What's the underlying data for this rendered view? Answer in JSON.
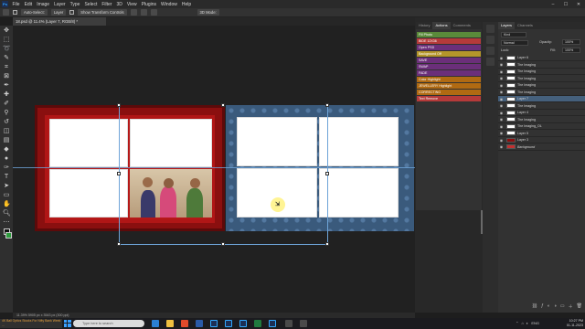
{
  "menu": [
    "File",
    "Edit",
    "Image",
    "Layer",
    "Type",
    "Select",
    "Filter",
    "3D",
    "View",
    "Plugins",
    "Window",
    "Help"
  ],
  "options": {
    "auto_select_label": "Auto-Select:",
    "layer_select": "Layer",
    "show_transform": "Show Transform Controls",
    "mode_3d": "3D Mode:"
  },
  "document": {
    "tab_title": "18.psd @ 11.4% (Layer 7, RGB/8) *",
    "status": "11.39%   5905 px x 3543 px (300 ppi)"
  },
  "panels": {
    "tabs": [
      "History",
      "Actions",
      "Comments"
    ],
    "active_tab": "Actions",
    "layers_tabs": [
      "Layers",
      "Channels"
    ]
  },
  "actions": [
    {
      "label": "Fill Photo",
      "color": "#5a8a3a"
    },
    {
      "label": "BIDE 12X36",
      "color": "#b53a3a"
    },
    {
      "label": "Open PSD",
      "color": "#6b2f7a"
    },
    {
      "label": "Background Off",
      "color": "#b4962a"
    },
    {
      "label": "SAVE",
      "color": "#6b2f7a"
    },
    {
      "label": "SWAP",
      "color": "#6b2f7a"
    },
    {
      "label": "FADE",
      "color": "#6b2f7a"
    },
    {
      "label": "Color Highlight",
      "color": "#b06a12"
    },
    {
      "label": "JEWELLERY Highlight",
      "color": "#b06a12"
    },
    {
      "label": "CORRECTING",
      "color": "#b06a12"
    },
    {
      "label": "Text Remove",
      "color": "#b53a3a"
    }
  ],
  "layers_panel": {
    "kind": "Kind",
    "mode": "Normal",
    "opacity_label": "Opacity:",
    "opacity": "100%",
    "lock_label": "Lock:",
    "fill_label": "Fill:",
    "fill": "100%",
    "rows": [
      {
        "name": "Layer 6",
        "selected": false
      },
      {
        "name": "The Imaging",
        "selected": false
      },
      {
        "name": "The Imaging",
        "selected": false
      },
      {
        "name": "The Imaging",
        "selected": false
      },
      {
        "name": "The Imaging",
        "selected": false
      },
      {
        "name": "The Imaging",
        "selected": false
      },
      {
        "name": "Layer 7",
        "selected": true
      },
      {
        "name": "The Imaging",
        "selected": false
      },
      {
        "name": "Layer 4",
        "selected": false
      },
      {
        "name": "The Imaging",
        "selected": false
      },
      {
        "name": "The Imaging_OL",
        "selected": false
      },
      {
        "name": "Layer 5",
        "selected": false
      },
      {
        "name": "Layer 3",
        "selected": false
      },
      {
        "name": "Background",
        "selected": false
      }
    ]
  },
  "taskbar": {
    "ticker": "4K Ball Optics Stocks For Nifty Bank Week ...",
    "search_placeholder": "Type here to search",
    "time": "10:27 PM",
    "date": "01-11-2023",
    "lang": "ENG"
  },
  "canvas_colors": {
    "left_border": "#8a0f0f",
    "right_bg": "#3a5a7c"
  }
}
